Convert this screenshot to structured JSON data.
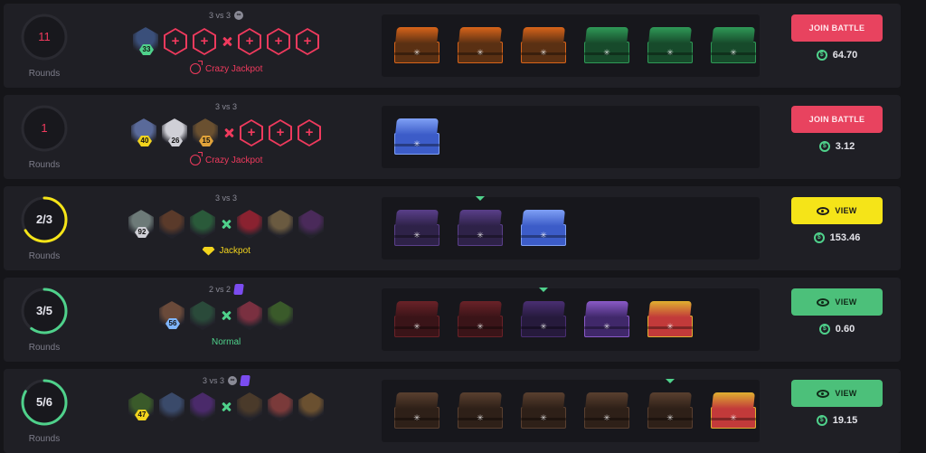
{
  "labels": {
    "rounds": "Rounds"
  },
  "icons": {
    "plus": "+",
    "coin": "$",
    "case_glyph": "✳",
    "mode": "∞"
  },
  "colors": {
    "accent_red": "#ef3a5d",
    "accent_green": "#4fd18b",
    "accent_yellow": "#f5e418"
  },
  "battles": [
    {
      "rounds": "11",
      "rounds_label": "Rounds",
      "rounds_style": "red-number",
      "progress": 0,
      "mode": "3 vs 3",
      "mode_icons": [
        "mode-icon"
      ],
      "team_a": [
        {
          "level": "33",
          "lvlcolor": "#4fd18b",
          "face": "#3a4f7a"
        },
        {
          "empty": true
        },
        {
          "empty": true
        }
      ],
      "team_b": [
        {
          "empty": true
        },
        {
          "empty": true
        },
        {
          "empty": true
        }
      ],
      "vs_color": "red",
      "type": "Crazy Jackpot",
      "type_icon": "bomb-icon",
      "type_color": "#ef3a5d",
      "cases": [
        {
          "lid": "#d8641a",
          "box": "#5a3013",
          "icon": "flame-case-icon"
        },
        {
          "lid": "#d8641a",
          "box": "#5a3013",
          "icon": "flame-case-icon"
        },
        {
          "lid": "#d8641a",
          "box": "#5a3013",
          "icon": "flame-case-icon"
        },
        {
          "lid": "#2f9a57",
          "box": "#174a2b",
          "icon": "green-case-icon"
        },
        {
          "lid": "#2f9a57",
          "box": "#174a2b",
          "icon": "green-case-icon"
        },
        {
          "lid": "#2f9a57",
          "box": "#174a2b",
          "icon": "green-case-icon"
        }
      ],
      "marker_index": -1,
      "action": "JOIN BATTLE",
      "action_style": "join",
      "price": "64.70"
    },
    {
      "rounds": "1",
      "rounds_label": "Rounds",
      "rounds_style": "red-number",
      "progress": 0,
      "mode": "3 vs 3",
      "mode_icons": [],
      "team_a": [
        {
          "level": "40",
          "lvlcolor": "#f2d41d",
          "face": "#5a6a9a"
        },
        {
          "level": "26",
          "lvlcolor": "#cfcfd6",
          "face": "#cfcfd6"
        },
        {
          "level": "15",
          "lvlcolor": "#e0a23a",
          "face": "#6a5030"
        }
      ],
      "team_b": [
        {
          "empty": true
        },
        {
          "empty": true
        },
        {
          "empty": true
        }
      ],
      "vs_color": "red",
      "type": "Crazy Jackpot",
      "type_icon": "bomb-icon",
      "type_color": "#ef3a5d",
      "cases": [
        {
          "lid": "#7fa0f5",
          "box": "#3c5cc8",
          "icon": "blue-case-icon"
        }
      ],
      "marker_index": -1,
      "action": "JOIN BATTLE",
      "action_style": "join",
      "price": "3.12"
    },
    {
      "rounds": "2/3",
      "rounds_label": "Rounds",
      "rounds_style": "ring",
      "ring_color": "#f5e418",
      "progress": 0.667,
      "mode": "3 vs 3",
      "mode_icons": [],
      "team_a": [
        {
          "level": "92",
          "lvlcolor": "#cfcfd6",
          "face": "#6d7a78"
        },
        {
          "face": "#5a3a2a"
        },
        {
          "face": "#2a5a3a"
        }
      ],
      "team_b": [
        {
          "face": "#8a2230"
        },
        {
          "face": "#6a5a40"
        },
        {
          "face": "#4a2a5a"
        }
      ],
      "vs_color": "green",
      "type": "Jackpot",
      "type_icon": "diamond-icon",
      "type_color": "#f2d41d",
      "cases": [
        {
          "lid": "#5a3f8a",
          "box": "#2e2248",
          "icon": "purple-case-icon"
        },
        {
          "lid": "#5a3f8a",
          "box": "#2e2248",
          "icon": "purple-case-icon"
        },
        {
          "lid": "#7fa0f5",
          "box": "#3c5cc8",
          "icon": "blue-case-icon"
        }
      ],
      "marker_index": 1,
      "action": "VIEW",
      "action_style": "view-y",
      "price": "153.46"
    },
    {
      "rounds": "3/5",
      "rounds_label": "Rounds",
      "rounds_style": "ring",
      "ring_color": "#4fd18b",
      "progress": 0.6,
      "mode": "2 vs 2",
      "mode_icons": [
        "group-icon"
      ],
      "team_a": [
        {
          "level": "56",
          "lvlcolor": "#7fb6ff",
          "face": "#6a4a3a"
        },
        {
          "face": "#2a4a3a"
        }
      ],
      "team_b": [
        {
          "face": "#7a3040"
        },
        {
          "face": "#3a5a2a"
        }
      ],
      "vs_color": "green",
      "type": "Normal",
      "type_icon": "",
      "type_color": "#4fd18b",
      "cases": [
        {
          "lid": "#6a2228",
          "box": "#3a1418",
          "icon": "red-case-icon"
        },
        {
          "lid": "#6a2228",
          "box": "#3a1418",
          "icon": "red-case-icon"
        },
        {
          "lid": "#4a2f72",
          "box": "#261a3c",
          "icon": "purple-case-icon"
        },
        {
          "lid": "#8a5ac8",
          "box": "#40286a",
          "icon": "purple-case-icon"
        },
        {
          "lid": "#e0b030",
          "box": "#c23a3a",
          "icon": "rainbow-case-icon"
        }
      ],
      "marker_index": 2,
      "action": "VIEW",
      "action_style": "view-g",
      "price": "0.60"
    },
    {
      "rounds": "5/6",
      "rounds_label": "Rounds",
      "rounds_style": "ring",
      "ring_color": "#4fd18b",
      "progress": 0.833,
      "mode": "3 vs 3",
      "mode_icons": [
        "mode-icon",
        "group-icon"
      ],
      "team_a": [
        {
          "level": "47",
          "lvlcolor": "#f2d41d",
          "face": "#3a5a2a"
        },
        {
          "face": "#3a4a6a"
        },
        {
          "face": "#4a2a6a"
        }
      ],
      "team_b": [
        {
          "face": "#4a3a2a"
        },
        {
          "face": "#7a3a3a"
        },
        {
          "face": "#6a5030"
        }
      ],
      "vs_color": "green",
      "type": "",
      "type_icon": "",
      "type_color": "#4fd18b",
      "cases": [
        {
          "lid": "#5a4030",
          "box": "#2e2018",
          "icon": "brown-case-icon"
        },
        {
          "lid": "#5a4030",
          "box": "#2e2018",
          "icon": "brown-case-icon"
        },
        {
          "lid": "#5a4030",
          "box": "#2e2018",
          "icon": "brown-case-icon"
        },
        {
          "lid": "#5a4030",
          "box": "#2e2018",
          "icon": "brown-case-icon"
        },
        {
          "lid": "#5a4030",
          "box": "#2e2018",
          "icon": "brown-case-icon"
        },
        {
          "lid": "#e0b030",
          "box": "#c23a3a",
          "icon": "rainbow-case-icon"
        }
      ],
      "marker_index": 4,
      "action": "VIEW",
      "action_style": "view-g",
      "price": "19.15"
    }
  ]
}
